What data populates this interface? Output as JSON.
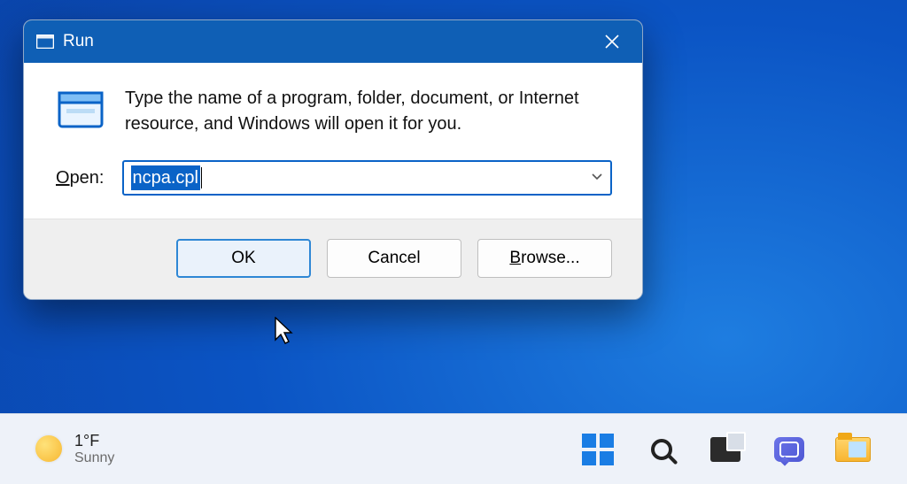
{
  "dialog": {
    "title": "Run",
    "description": "Type the name of a program, folder, document, or Internet resource, and Windows will open it for you.",
    "open_label_underlined": "O",
    "open_label_rest": "pen:",
    "input_value": "ncpa.cpl",
    "ok_label": "OK",
    "cancel_label": "Cancel",
    "browse_underlined": "B",
    "browse_rest": "rowse..."
  },
  "taskbar": {
    "temperature": "1°F",
    "condition": "Sunny"
  }
}
